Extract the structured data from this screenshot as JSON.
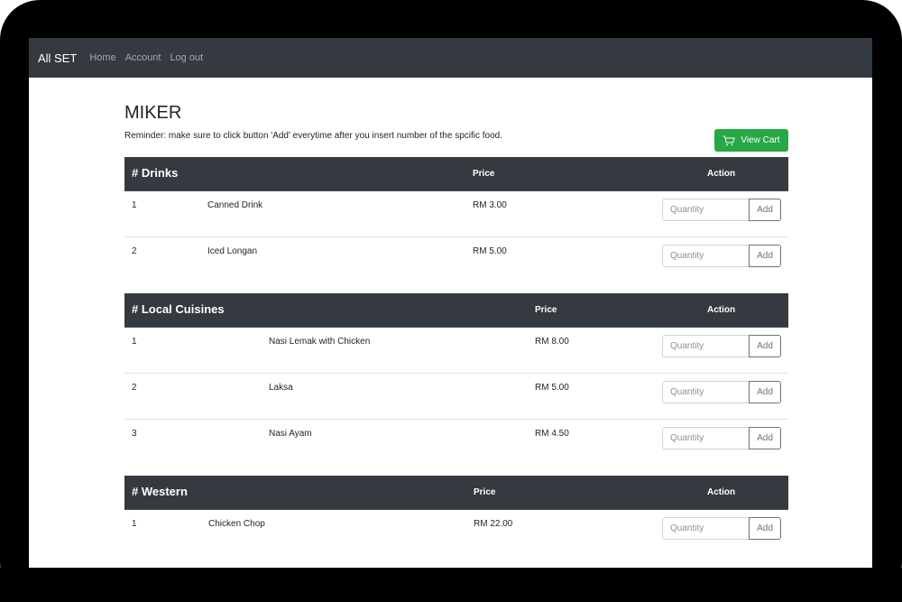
{
  "nav": {
    "brand": "All SET",
    "links": [
      "Home",
      "Account",
      "Log out"
    ]
  },
  "page": {
    "title": "MIKER",
    "reminder": "Reminder: make sure to click button 'Add' everytime after you insert number of the spcific food.",
    "view_cart_label": "View Cart",
    "price_header": "Price",
    "action_header": "Action",
    "quantity_placeholder": "Quantity",
    "add_label": "Add"
  },
  "categories": [
    {
      "name": "# Drinks",
      "items": [
        {
          "num": "1",
          "name": "Canned Drink",
          "price": "RM 3.00"
        },
        {
          "num": "2",
          "name": "Iced Longan",
          "price": "RM 5.00"
        }
      ]
    },
    {
      "name": "# Local Cuisines",
      "items": [
        {
          "num": "1",
          "name": "Nasi Lemak with Chicken",
          "price": "RM 8.00"
        },
        {
          "num": "2",
          "name": "Laksa",
          "price": "RM 5.00"
        },
        {
          "num": "3",
          "name": "Nasi Ayam",
          "price": "RM 4.50"
        }
      ]
    },
    {
      "name": "# Western",
      "items": [
        {
          "num": "1",
          "name": "Chicken Chop",
          "price": "RM 22.00"
        }
      ]
    }
  ],
  "colors": {
    "navbar": "#343a40",
    "button_success": "#28a745",
    "device_frame": "#000000"
  }
}
